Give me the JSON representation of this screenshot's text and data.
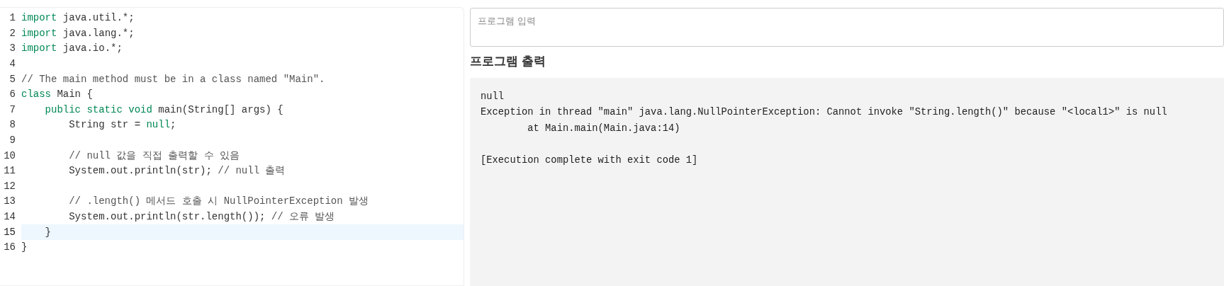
{
  "editor": {
    "lines": [
      {
        "number": "1",
        "active": false,
        "tokens": [
          {
            "kind": "keyword",
            "text": "import"
          },
          {
            "kind": "plain",
            "text": " java.util.*;"
          }
        ]
      },
      {
        "number": "2",
        "active": false,
        "tokens": [
          {
            "kind": "keyword",
            "text": "import"
          },
          {
            "kind": "plain",
            "text": " java.lang.*;"
          }
        ]
      },
      {
        "number": "3",
        "active": false,
        "tokens": [
          {
            "kind": "keyword",
            "text": "import"
          },
          {
            "kind": "plain",
            "text": " java.io.*;"
          }
        ]
      },
      {
        "number": "4",
        "active": false
      },
      {
        "number": "5",
        "active": false,
        "tokens": [
          {
            "kind": "comment",
            "text": "// The main method must be in a class named \"Main\"."
          }
        ]
      },
      {
        "number": "6",
        "active": false,
        "tokens": [
          {
            "kind": "keyword",
            "text": "class"
          },
          {
            "kind": "plain",
            "text": " Main {"
          }
        ]
      },
      {
        "number": "7",
        "active": false,
        "tokens": [
          {
            "kind": "keyword",
            "text": "    public static void"
          },
          {
            "kind": "plain",
            "text": " main(String[] args) {"
          }
        ]
      },
      {
        "number": "8",
        "active": false,
        "tokens": [
          {
            "kind": "plain",
            "text": "        String str = "
          },
          {
            "kind": "keyword",
            "text": "null"
          },
          {
            "kind": "plain",
            "text": ";"
          }
        ]
      },
      {
        "number": "9",
        "active": false
      },
      {
        "number": "10",
        "active": false,
        "tokens": [
          {
            "kind": "comment",
            "text": "        // null 값을 직접 출력할 수 있음"
          }
        ]
      },
      {
        "number": "11",
        "active": false,
        "tokens": [
          {
            "kind": "plain",
            "text": "        System.out.println(str); "
          },
          {
            "kind": "comment",
            "text": "// null 출력"
          }
        ]
      },
      {
        "number": "12",
        "active": false
      },
      {
        "number": "13",
        "active": false,
        "tokens": [
          {
            "kind": "comment",
            "text": "        // .length() 메서드 호출 시 NullPointerException 발생"
          }
        ]
      },
      {
        "number": "14",
        "active": false,
        "tokens": [
          {
            "kind": "plain",
            "text": "        System.out.println(str.length()); "
          },
          {
            "kind": "comment",
            "text": "// 오류 발생"
          }
        ]
      },
      {
        "number": "15",
        "active": true,
        "tokens": [
          {
            "kind": "plain",
            "text": "    }"
          }
        ]
      },
      {
        "number": "16",
        "active": false,
        "tokens": [
          {
            "kind": "plain",
            "text": "}"
          }
        ]
      }
    ]
  },
  "input": {
    "placeholder": "프로그램 입력"
  },
  "output": {
    "heading": "프로그램 출력",
    "blocks": [
      [
        "null",
        "Exception in thread \"main\" java.lang.NullPointerException: Cannot invoke \"String.length()\" because \"<local1>\" is null",
        "        at Main.main(Main.java:14)"
      ],
      [
        "[Execution complete with exit code 1]"
      ]
    ]
  }
}
